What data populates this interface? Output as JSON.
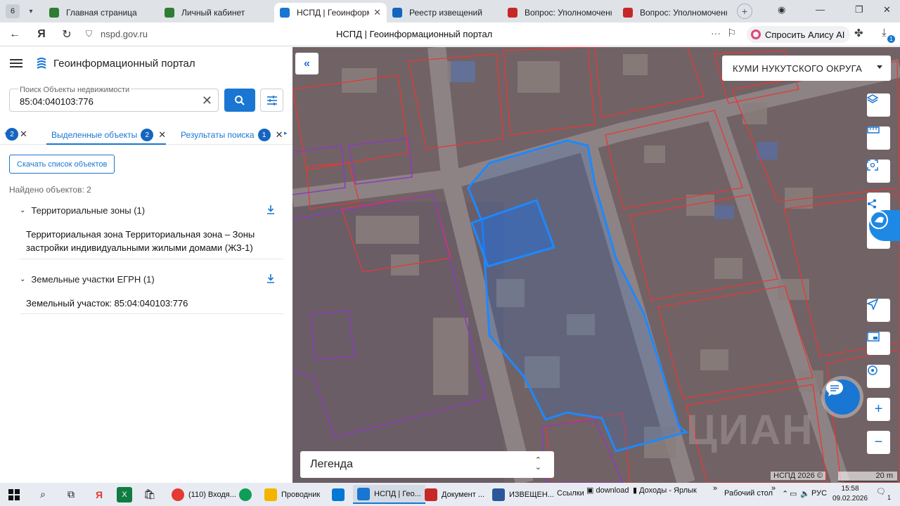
{
  "browser": {
    "tab_count": "6",
    "tabs": [
      {
        "title": "Главная страница",
        "color": "#2e7d32"
      },
      {
        "title": "Личный кабинет",
        "color": "#2e7d32"
      },
      {
        "title": "НСПД | Геоинформац",
        "color": "#1976d2"
      },
      {
        "title": "Реестр извещений",
        "color": "#1565c0"
      },
      {
        "title": "Вопрос: Уполномоченн",
        "color": "#c62828"
      },
      {
        "title": "Вопрос: Уполномоченн",
        "color": "#c62828"
      }
    ],
    "active_tab_index": 2,
    "url": "nspd.gov.ru",
    "page_title": "НСПД | Геоинформационный портал",
    "alisa_label": "Спросить Алису AI",
    "download_badge": "1"
  },
  "sidebar": {
    "app_title": "Геоинформационный портал",
    "search": {
      "label": "Поиск Объекты недвижимости",
      "value": "85:04:040103:776"
    },
    "tabs": {
      "partial_badge": "2",
      "selected_label": "Выделенные объекты",
      "selected_badge": "2",
      "results_label": "Результаты поиска",
      "results_badge": "1"
    },
    "download_list_label": "Скачать список объектов",
    "found_text": "Найдено объектов: 2",
    "groups": [
      {
        "title": "Территориальные зоны (1)",
        "item": "Территориальная зона Территориальная зона – Зоны застройки индивидуальными жилыми домами (ЖЗ-1)"
      },
      {
        "title": "Земельные участки ЕГРН (1)",
        "item": "Земельный участок: 85:04:040103:776"
      }
    ]
  },
  "map": {
    "district_selector": "КУМИ НУКУТСКОГО ОКРУГА",
    "legend_label": "Легенда",
    "attribution": "НСПД 2026 ©",
    "scale_label": "20 m",
    "parcel_color": "#1e88ff",
    "boundary_color": "#e53935",
    "zone_color": "#7b3fa8",
    "watermark": "ЦИАН"
  },
  "taskbar": {
    "apps": [
      {
        "label": "(110) Входя...",
        "color": "#e53935"
      },
      {
        "label": "",
        "color": "#0f9d58"
      },
      {
        "label": "Проводник",
        "color": "#f4b400"
      },
      {
        "label": "",
        "color": "#0078d4"
      },
      {
        "label": "НСПД | Гео...",
        "color": "#1976d2"
      },
      {
        "label": "Документ ...",
        "color": "#c62828"
      },
      {
        "label": "ИЗВЕЩЕН...",
        "color": "#2b579a"
      }
    ],
    "links_label": "Ссылки",
    "download_label": "download",
    "income_label": "Доходы - Ярлык",
    "desktop_label": "Рабочий стол",
    "language": "РУС",
    "time": "15:58",
    "date": "09.02.2026",
    "notification_count": "1"
  }
}
